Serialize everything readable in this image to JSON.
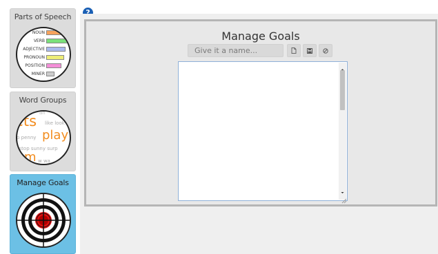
{
  "sidebar": {
    "cards": [
      {
        "title": "Parts of Speech"
      },
      {
        "title": "Word Groups"
      },
      {
        "title": "Manage Goals"
      }
    ],
    "pos_labels": [
      "NOUN",
      "VERB",
      "ADJECTIVE",
      "PRONOUN",
      "POSITION",
      "MINER"
    ],
    "pos_colors": [
      "#f7a35c",
      "#7be07b",
      "#a9b9ee",
      "#eeee77",
      "#f48fd8",
      "#cccccc"
    ],
    "word_groups": {
      "top": "an",
      "big1": "ets",
      "small1": "like look",
      "small2": "p penny",
      "big2": "play",
      "line3": "e stop sunny surp",
      "big3": "m",
      "small3": "w wa"
    }
  },
  "help": {
    "glyph": "?"
  },
  "panel": {
    "title": "Manage Goals",
    "name_placeholder": "Give it a name...",
    "editor_value": ""
  },
  "colors": {
    "active_card": "#6cc0e5",
    "help_icon": "#1a5fb4",
    "target_red": "#e01010"
  }
}
